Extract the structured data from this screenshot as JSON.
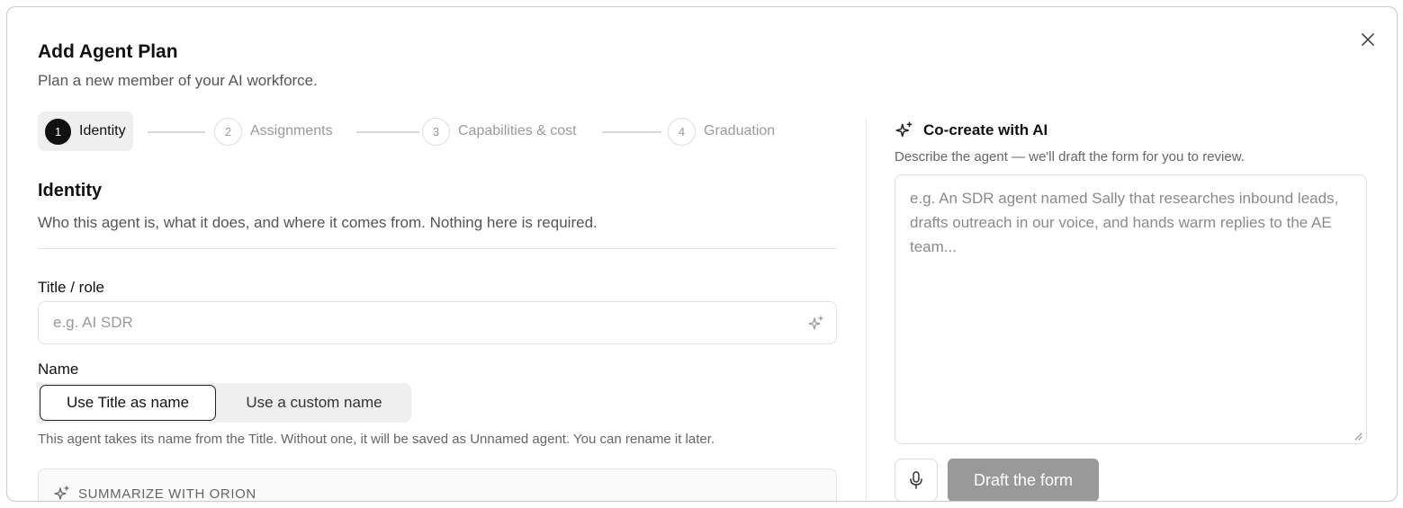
{
  "dialog": {
    "title": "Add Agent Plan",
    "subtitle": "Plan a new member of your AI workforce.",
    "close_icon": "close-icon"
  },
  "stepper": {
    "steps": [
      {
        "number": "1",
        "label": "Identity",
        "active": true
      },
      {
        "number": "2",
        "label": "Assignments",
        "active": false
      },
      {
        "number": "3",
        "label": "Capabilities & cost",
        "active": false
      },
      {
        "number": "4",
        "label": "Graduation",
        "active": false
      }
    ]
  },
  "identity": {
    "title": "Identity",
    "description": "Who this agent is, what it does, and where it comes from. Nothing here is required.",
    "title_field": {
      "label": "Title / role",
      "placeholder": "e.g. AI SDR",
      "value": "",
      "icon": "sparkle-icon"
    },
    "name_field": {
      "label": "Name",
      "options": [
        "Use Title as name",
        "Use a custom name"
      ],
      "selected": "Use Title as name",
      "hint": "This agent takes its name from the Title. Without one, it will be saved as Unnamed agent. You can rename it later."
    },
    "summarize": {
      "label": "SUMMARIZE WITH ORION",
      "icon": "sparkle-icon"
    }
  },
  "cocreate": {
    "title": "Co-create with AI",
    "description": "Describe the agent — we'll draft the form for you to review.",
    "placeholder": "e.g. An SDR agent named Sally that researches inbound leads, drafts outreach in our voice, and hands warm replies to the AE team...",
    "value": "",
    "mic_icon": "microphone-icon",
    "draft_button": "Draft the form"
  },
  "colors": {
    "active_step": "#111111",
    "draft_button_disabled": "#999999",
    "border": "#e0e0e0"
  }
}
